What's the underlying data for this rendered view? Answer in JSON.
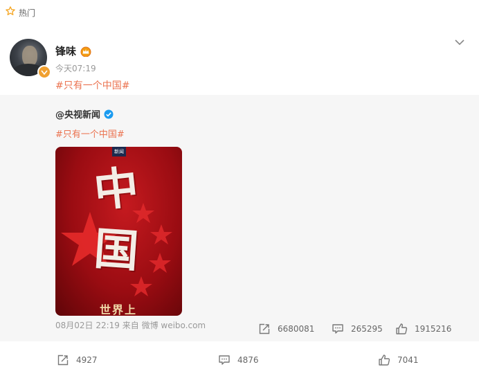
{
  "header_tag": {
    "label": "热门"
  },
  "post": {
    "author": "锋味",
    "time": "今天07:19",
    "topic": "#只有一个中国#"
  },
  "repost": {
    "author": "@央视新闻",
    "topic": "#只有一个中国#",
    "image": {
      "logo_text": "新闻",
      "characters": [
        "中",
        "国"
      ],
      "subline": "世界上"
    },
    "meta": "08月02日 22:19 来自 微博 weibo.com",
    "stats": {
      "reposts": "6680081",
      "comments": "265295",
      "likes": "1915216"
    }
  },
  "actions": {
    "reposts": "4927",
    "comments": "4876",
    "likes": "7041"
  },
  "colors": {
    "accent": "#eb7350",
    "hot_star": "#f5a623",
    "verify_blue": "#1a9bf0"
  },
  "icons": [
    "star-outline-icon",
    "crown-vip-icon",
    "verified-icon",
    "chevron-down-icon",
    "repost-icon",
    "comment-icon",
    "like-icon"
  ]
}
